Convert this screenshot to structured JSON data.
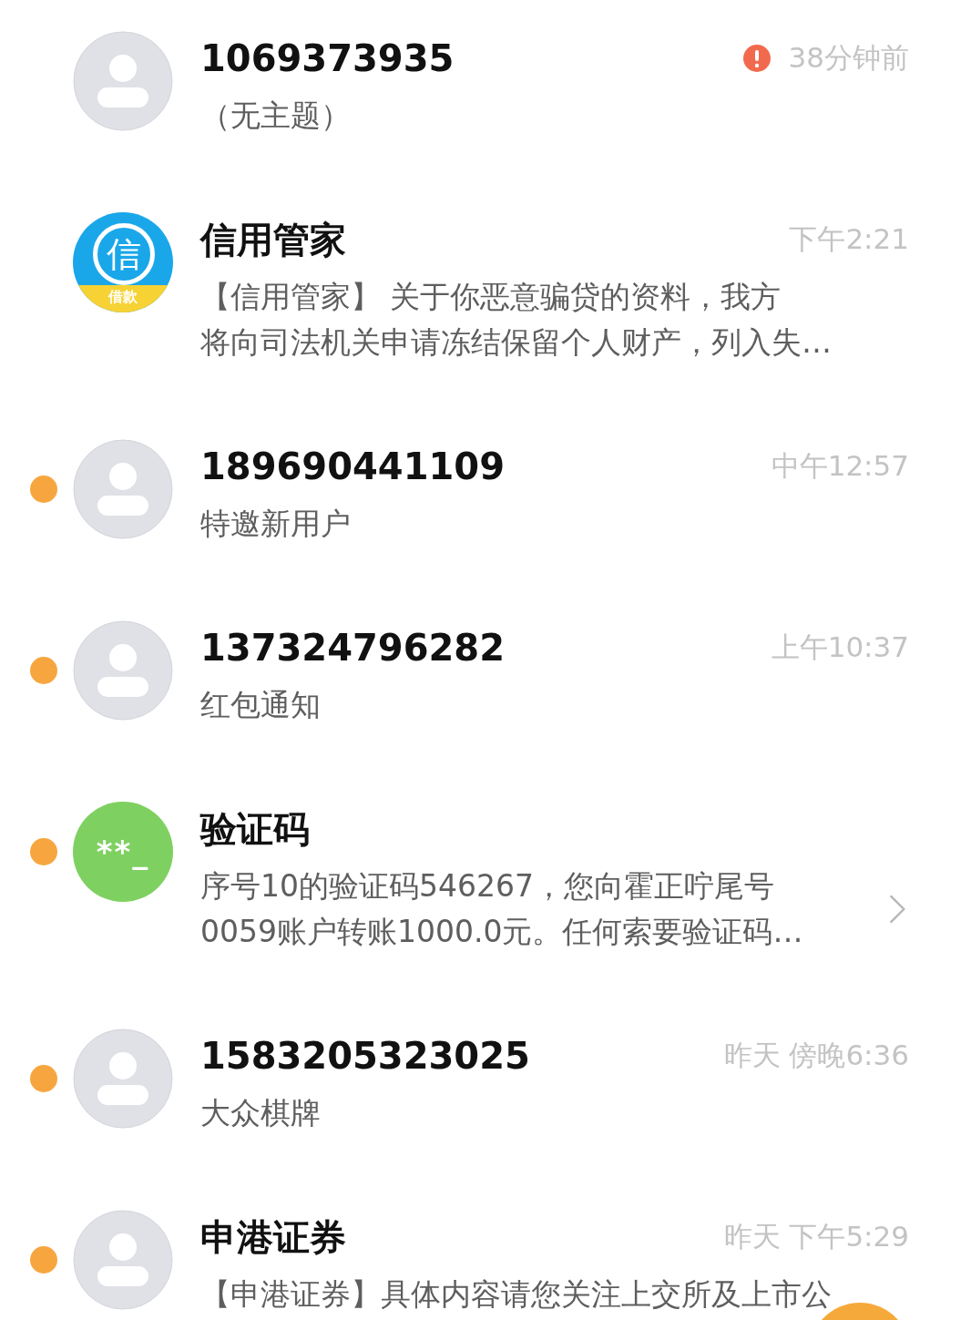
{
  "conversations": [
    {
      "title": "1069373935",
      "time": "38分钟前",
      "failed": true,
      "unread": false,
      "chevron": false,
      "avatar": {
        "kind": "default"
      },
      "preview": [
        "（无主题）"
      ]
    },
    {
      "title": "信用管家",
      "time": "下午2:21",
      "failed": false,
      "unread": false,
      "chevron": false,
      "avatar": {
        "kind": "credit",
        "glyph": "信",
        "tag": "借款"
      },
      "preview": [
        "【信用管家】 关于你恶意骗贷的资料，我方",
        "将向司法机关申请冻结保留个人财产，列入失…"
      ]
    },
    {
      "title": "189690441109",
      "time": "中午12:57",
      "failed": false,
      "unread": true,
      "chevron": false,
      "avatar": {
        "kind": "default"
      },
      "preview": [
        "特邀新用户"
      ]
    },
    {
      "title": "137324796282",
      "time": "上午10:37",
      "failed": false,
      "unread": true,
      "chevron": false,
      "avatar": {
        "kind": "default"
      },
      "preview": [
        "红包通知"
      ]
    },
    {
      "title": "验证码",
      "failed": false,
      "unread": true,
      "chevron": true,
      "avatar": {
        "kind": "code",
        "glyph": "**_"
      },
      "preview": [
        "序号10的验证码546267，您向霍正咛尾号",
        "0059账户转账1000.0元。任何索要验证码…"
      ]
    },
    {
      "title": "1583205323025",
      "time": "昨天 傍晚6:36",
      "failed": false,
      "unread": true,
      "chevron": false,
      "avatar": {
        "kind": "default"
      },
      "preview": [
        "大众棋牌"
      ]
    },
    {
      "title": "申港证券",
      "time": "昨天 下午5:29",
      "failed": false,
      "unread": true,
      "chevron": false,
      "avatar": {
        "kind": "default"
      },
      "preview": [
        "【申港证券】具体内容请您关注上交所及上市公"
      ]
    }
  ]
}
